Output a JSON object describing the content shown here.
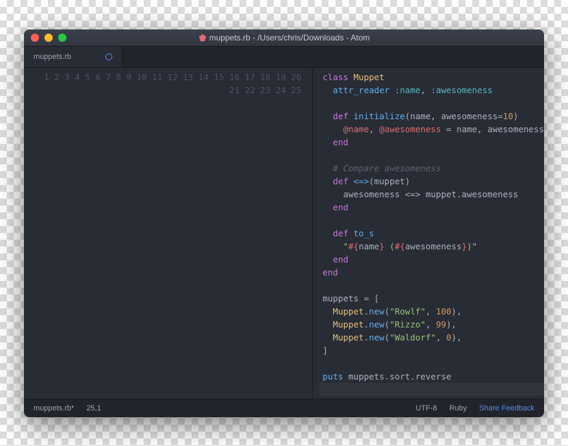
{
  "window": {
    "title": "muppets.rb - /Users/chris/Downloads - Atom",
    "file_icon": "rb"
  },
  "tabs": [
    {
      "label": "muppets.rb",
      "modified": true
    }
  ],
  "gutter": {
    "start": 1,
    "end": 25
  },
  "code_lines": [
    [
      [
        "kw",
        "class "
      ],
      [
        "cls",
        "Muppet"
      ]
    ],
    [
      [
        "plain",
        "  "
      ],
      [
        "fn",
        "attr_reader"
      ],
      [
        "plain",
        " "
      ],
      [
        "sym",
        ":name"
      ],
      [
        "plain",
        ", "
      ],
      [
        "sym",
        ":awesomeness"
      ]
    ],
    [],
    [
      [
        "plain",
        "  "
      ],
      [
        "kw",
        "def "
      ],
      [
        "fn",
        "initialize"
      ],
      [
        "plain",
        "(name, awesomeness="
      ],
      [
        "num",
        "10"
      ],
      [
        "plain",
        ")"
      ]
    ],
    [
      [
        "plain",
        "    "
      ],
      [
        "ivar",
        "@name"
      ],
      [
        "plain",
        ", "
      ],
      [
        "ivar",
        "@awesomeness"
      ],
      [
        "plain",
        " = name, awesomeness"
      ]
    ],
    [
      [
        "plain",
        "  "
      ],
      [
        "kw",
        "end"
      ]
    ],
    [],
    [
      [
        "plain",
        "  "
      ],
      [
        "cmnt",
        "# Compare awesomeness"
      ]
    ],
    [
      [
        "plain",
        "  "
      ],
      [
        "kw",
        "def "
      ],
      [
        "fn",
        "<=>"
      ],
      [
        "plain",
        "(muppet)"
      ]
    ],
    [
      [
        "plain",
        "    awesomeness <=> muppet.awesomeness"
      ]
    ],
    [
      [
        "plain",
        "  "
      ],
      [
        "kw",
        "end"
      ]
    ],
    [],
    [
      [
        "plain",
        "  "
      ],
      [
        "kw",
        "def "
      ],
      [
        "fn",
        "to_s"
      ]
    ],
    [
      [
        "plain",
        "    "
      ],
      [
        "str",
        "\""
      ],
      [
        "intrp",
        "#{"
      ],
      [
        "plain",
        "name"
      ],
      [
        "intrp",
        "}"
      ],
      [
        "str",
        " ("
      ],
      [
        "intrp",
        "#{"
      ],
      [
        "plain",
        "awesomeness"
      ],
      [
        "intrp",
        "}"
      ],
      [
        "str",
        ")\""
      ]
    ],
    [
      [
        "plain",
        "  "
      ],
      [
        "kw",
        "end"
      ]
    ],
    [
      [
        "kw",
        "end"
      ]
    ],
    [],
    [
      [
        "plain",
        "muppets = ["
      ]
    ],
    [
      [
        "plain",
        "  "
      ],
      [
        "cls",
        "Muppet"
      ],
      [
        "plain",
        "."
      ],
      [
        "fn",
        "new"
      ],
      [
        "plain",
        "("
      ],
      [
        "str",
        "\"Rowlf\""
      ],
      [
        "plain",
        ", "
      ],
      [
        "num",
        "100"
      ],
      [
        "plain",
        "),"
      ]
    ],
    [
      [
        "plain",
        "  "
      ],
      [
        "cls",
        "Muppet"
      ],
      [
        "plain",
        "."
      ],
      [
        "fn",
        "new"
      ],
      [
        "plain",
        "("
      ],
      [
        "str",
        "\"Rizzo\""
      ],
      [
        "plain",
        ", "
      ],
      [
        "num",
        "99"
      ],
      [
        "plain",
        "),"
      ]
    ],
    [
      [
        "plain",
        "  "
      ],
      [
        "cls",
        "Muppet"
      ],
      [
        "plain",
        "."
      ],
      [
        "fn",
        "new"
      ],
      [
        "plain",
        "("
      ],
      [
        "str",
        "\"Waldorf\""
      ],
      [
        "plain",
        ", "
      ],
      [
        "num",
        "0"
      ],
      [
        "plain",
        "),"
      ]
    ],
    [
      [
        "plain",
        "]"
      ]
    ],
    [],
    [
      [
        "fn",
        "puts"
      ],
      [
        "plain",
        " muppets.sort.reverse"
      ]
    ],
    []
  ],
  "cursor_line_index": 24,
  "status": {
    "file": "muppets.rb*",
    "pos": "25,1",
    "encoding": "UTF-8",
    "lang": "Ruby",
    "feedback": "Share Feedback"
  }
}
